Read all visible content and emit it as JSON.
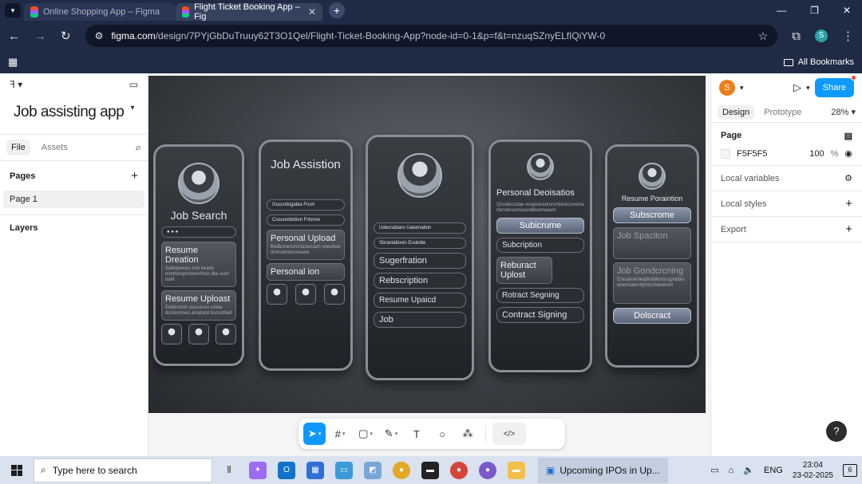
{
  "browser": {
    "tabs": [
      {
        "title": "Online Shopping App – Figma"
      },
      {
        "title": "Flight Ticket Booking App – Fig"
      }
    ],
    "url_domain": "figma.com",
    "url_path": "/design/7PYjGbDuTruuy62T3O1Qel/Flight-Ticket-Booking-App?node-id=0-1&p=f&t=nzuqSZnyELfIQiYW-0",
    "profile_initial": "S",
    "bookmarks_label": "All Bookmarks"
  },
  "sidebar": {
    "project_name": "Job assisting app",
    "tabs": [
      "File",
      "Assets"
    ],
    "pages_label": "Pages",
    "page_item": "Page 1",
    "layers_label": "Layers"
  },
  "canvas": {
    "phones": [
      {
        "title": "Job Search",
        "cards": [
          {
            "title": "Resume Dreation",
            "text": "Safetyweiss cnit bearly oonthonpnonnerhicin diw aunt nahl"
          },
          {
            "title": "Resume Uploast",
            "text": "Eelbionioh yocuesso cxlxie dccreonnes alnatulat bsrnotheit"
          }
        ]
      },
      {
        "title": "Job Assistion",
        "pills": [
          "Guccoilcgabia Frum",
          "Cssunobiotion Frtonve"
        ],
        "cards": [
          {
            "title": "Personal Upload",
            "text": "Beliboneriuncluiduruam ooeeboe dnonamorinneane"
          },
          {
            "title": "Personal    ion",
            "text": ""
          }
        ]
      },
      {
        "title": "",
        "pills": [
          "Udecrabiaro  Uaternation",
          "Sbrastatiovin  Eoolobe"
        ],
        "buttons": [
          "Sugerfration",
          "Rebscription",
          "Resume Upaicd",
          "Job"
        ]
      },
      {
        "title": "Personal Deoisatios",
        "text": "Qoodecudae ouupetcaotoruntiexiconemarterstersumisandbieemaaetr",
        "buttons": [
          "Subicrume",
          "Subcription",
          "Reburact Uplost",
          "Rotract Segning",
          "Contract Signing"
        ]
      },
      {
        "title": "Resume Poraintion",
        "buttons": [
          "Subscrome",
          "Dolscract"
        ],
        "cards": [
          {
            "title": "Job Spaciton",
            "text": ""
          },
          {
            "title": "Job Gondcrcning",
            "text": "Ereuamenieipbrabbonusgnaibineeertuatenhpmicrtiatwionn"
          }
        ]
      }
    ]
  },
  "toolbar": {
    "dev_mode_icon": "code-icon"
  },
  "right_panel": {
    "user_initial": "S",
    "share_label": "Share",
    "tabs": [
      "Design",
      "Prototype"
    ],
    "zoom": "28%",
    "page_label": "Page",
    "bg_color": "F5F5F5",
    "bg_opacity": "100",
    "opacity_unit": "%",
    "local_variables": "Local variables",
    "local_styles": "Local styles",
    "export": "Export",
    "help": "?"
  },
  "taskbar": {
    "search_placeholder": "Type here to search",
    "active_app": "Upcoming IPOs in Up...",
    "lang": "ENG",
    "time": "23:04",
    "date": "23-02-2025",
    "notifications": "6"
  }
}
